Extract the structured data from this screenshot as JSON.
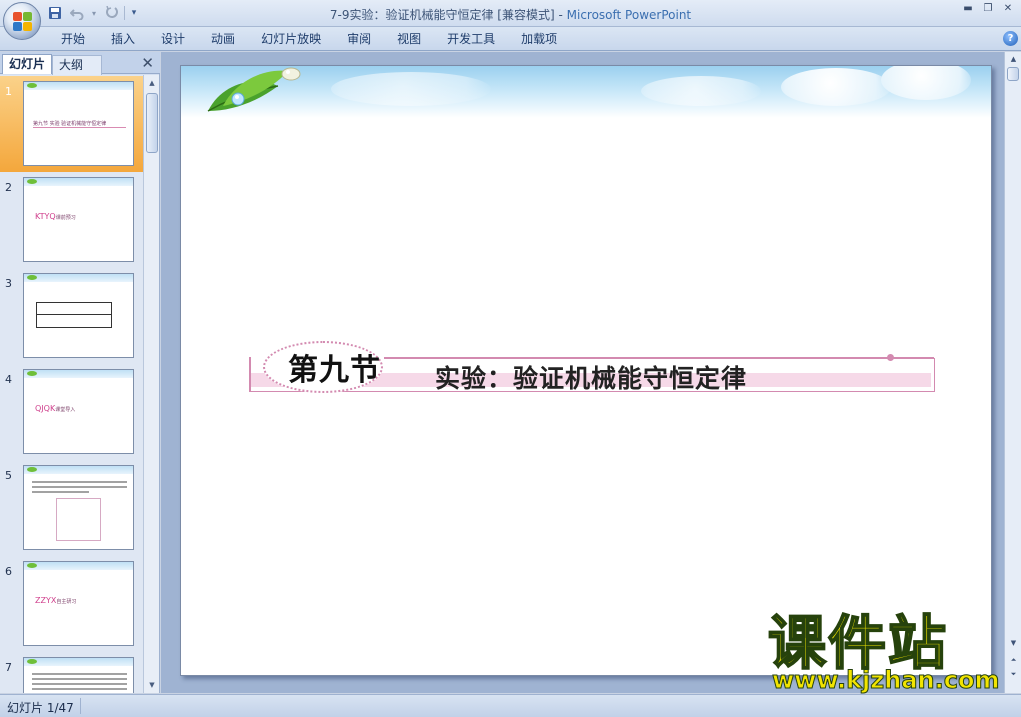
{
  "window": {
    "title_doc": "7-9实验：验证机械能守恒定律 [兼容模式] - ",
    "title_app": "Microsoft PowerPoint"
  },
  "qat": {
    "save_icon": "save-icon",
    "undo_icon": "undo-icon",
    "redo_icon": "redo-icon"
  },
  "ribbon": {
    "tabs": [
      "开始",
      "插入",
      "设计",
      "动画",
      "幻灯片放映",
      "审阅",
      "视图",
      "开发工具",
      "加载项"
    ]
  },
  "panel": {
    "tab_slides": "幻灯片",
    "tab_outline": "大纲",
    "thumbs": [
      {
        "num": "1",
        "label": "第九节    实验  验证机械能守恒定律"
      },
      {
        "num": "2",
        "label": "KTYQ",
        "sub": "课前预习"
      },
      {
        "num": "3",
        "label": ""
      },
      {
        "num": "4",
        "label": "QJQK",
        "sub": "课堂导入"
      },
      {
        "num": "5",
        "label": ""
      },
      {
        "num": "6",
        "label": "ZZYX",
        "sub": "自主研习"
      },
      {
        "num": "7",
        "label": ""
      }
    ]
  },
  "slide": {
    "badge": "第九节",
    "title": "实验：验证机械能守恒定律"
  },
  "watermark": {
    "cn": "课件站",
    "url": "www.kjzhan.com"
  },
  "status": {
    "slide_counter": "幻灯片 1/47"
  },
  "colors": {
    "accent_pink": "#d38ab0",
    "selected_thumb": "#f4a73c",
    "watermark_yellow": "#f2e400"
  }
}
